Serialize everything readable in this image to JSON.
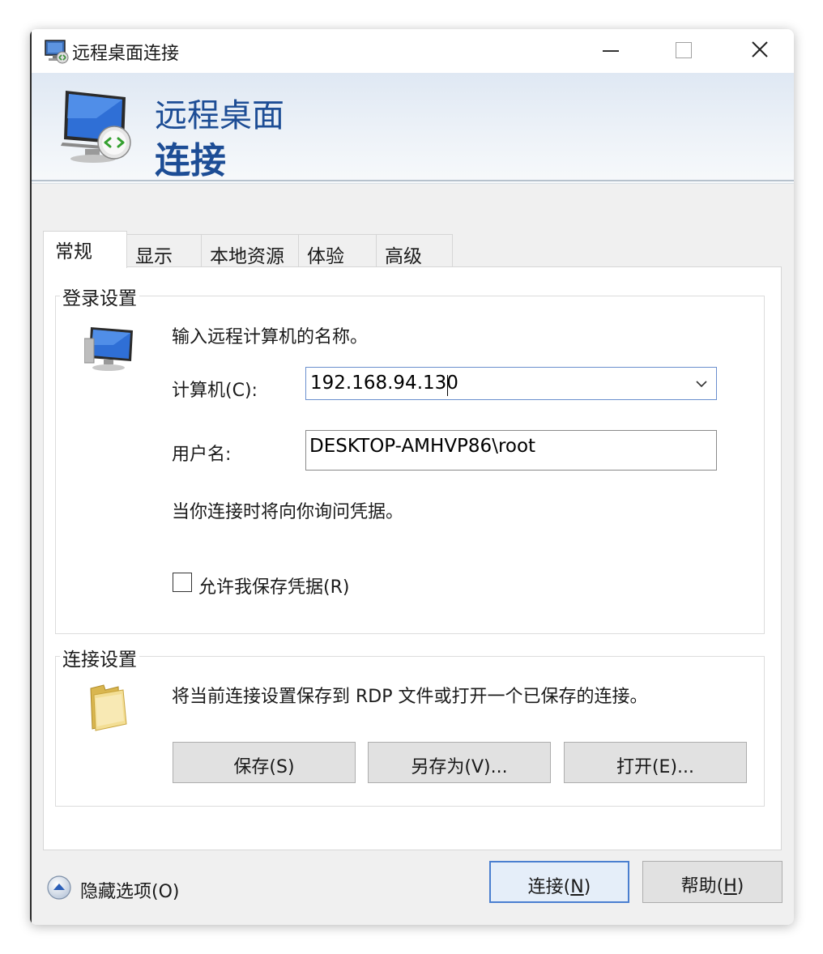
{
  "window": {
    "title": "远程桌面连接",
    "banner_line1": "远程桌面",
    "banner_line2": "连接"
  },
  "tabs": [
    {
      "label": "常规",
      "active": true
    },
    {
      "label": "显示",
      "active": false
    },
    {
      "label": "本地资源",
      "active": false
    },
    {
      "label": "体验",
      "active": false
    },
    {
      "label": "高级",
      "active": false
    }
  ],
  "login_settings": {
    "group_title": "登录设置",
    "instruction": "输入远程计算机的名称。",
    "computer_label": "计算机(C):",
    "computer_value": "192.168.94.130",
    "username_label": "用户名:",
    "username_value": "DESKTOP-AMHVP86\\root",
    "credential_note": "当你连接时将向你询问凭据。",
    "save_credentials_label": "允许我保存凭据(R)",
    "save_credentials_checked": false
  },
  "connection_settings": {
    "group_title": "连接设置",
    "description": "将当前连接设置保存到 RDP 文件或打开一个已保存的连接。",
    "save_label": "保存(S)",
    "save_as_label": "另存为(V)...",
    "open_label": "打开(E)..."
  },
  "footer": {
    "hide_options_label": "隐藏选项(O)",
    "connect_label_pre": "连接(",
    "connect_accel": "N",
    "connect_label_post": ")",
    "help_label_pre": "帮助(",
    "help_accel": "H",
    "help_label_post": ")"
  },
  "colors": {
    "banner_text": "#1d4d95",
    "default_button_border": "#4a7fd0",
    "window_bg": "#f0f0f0"
  }
}
